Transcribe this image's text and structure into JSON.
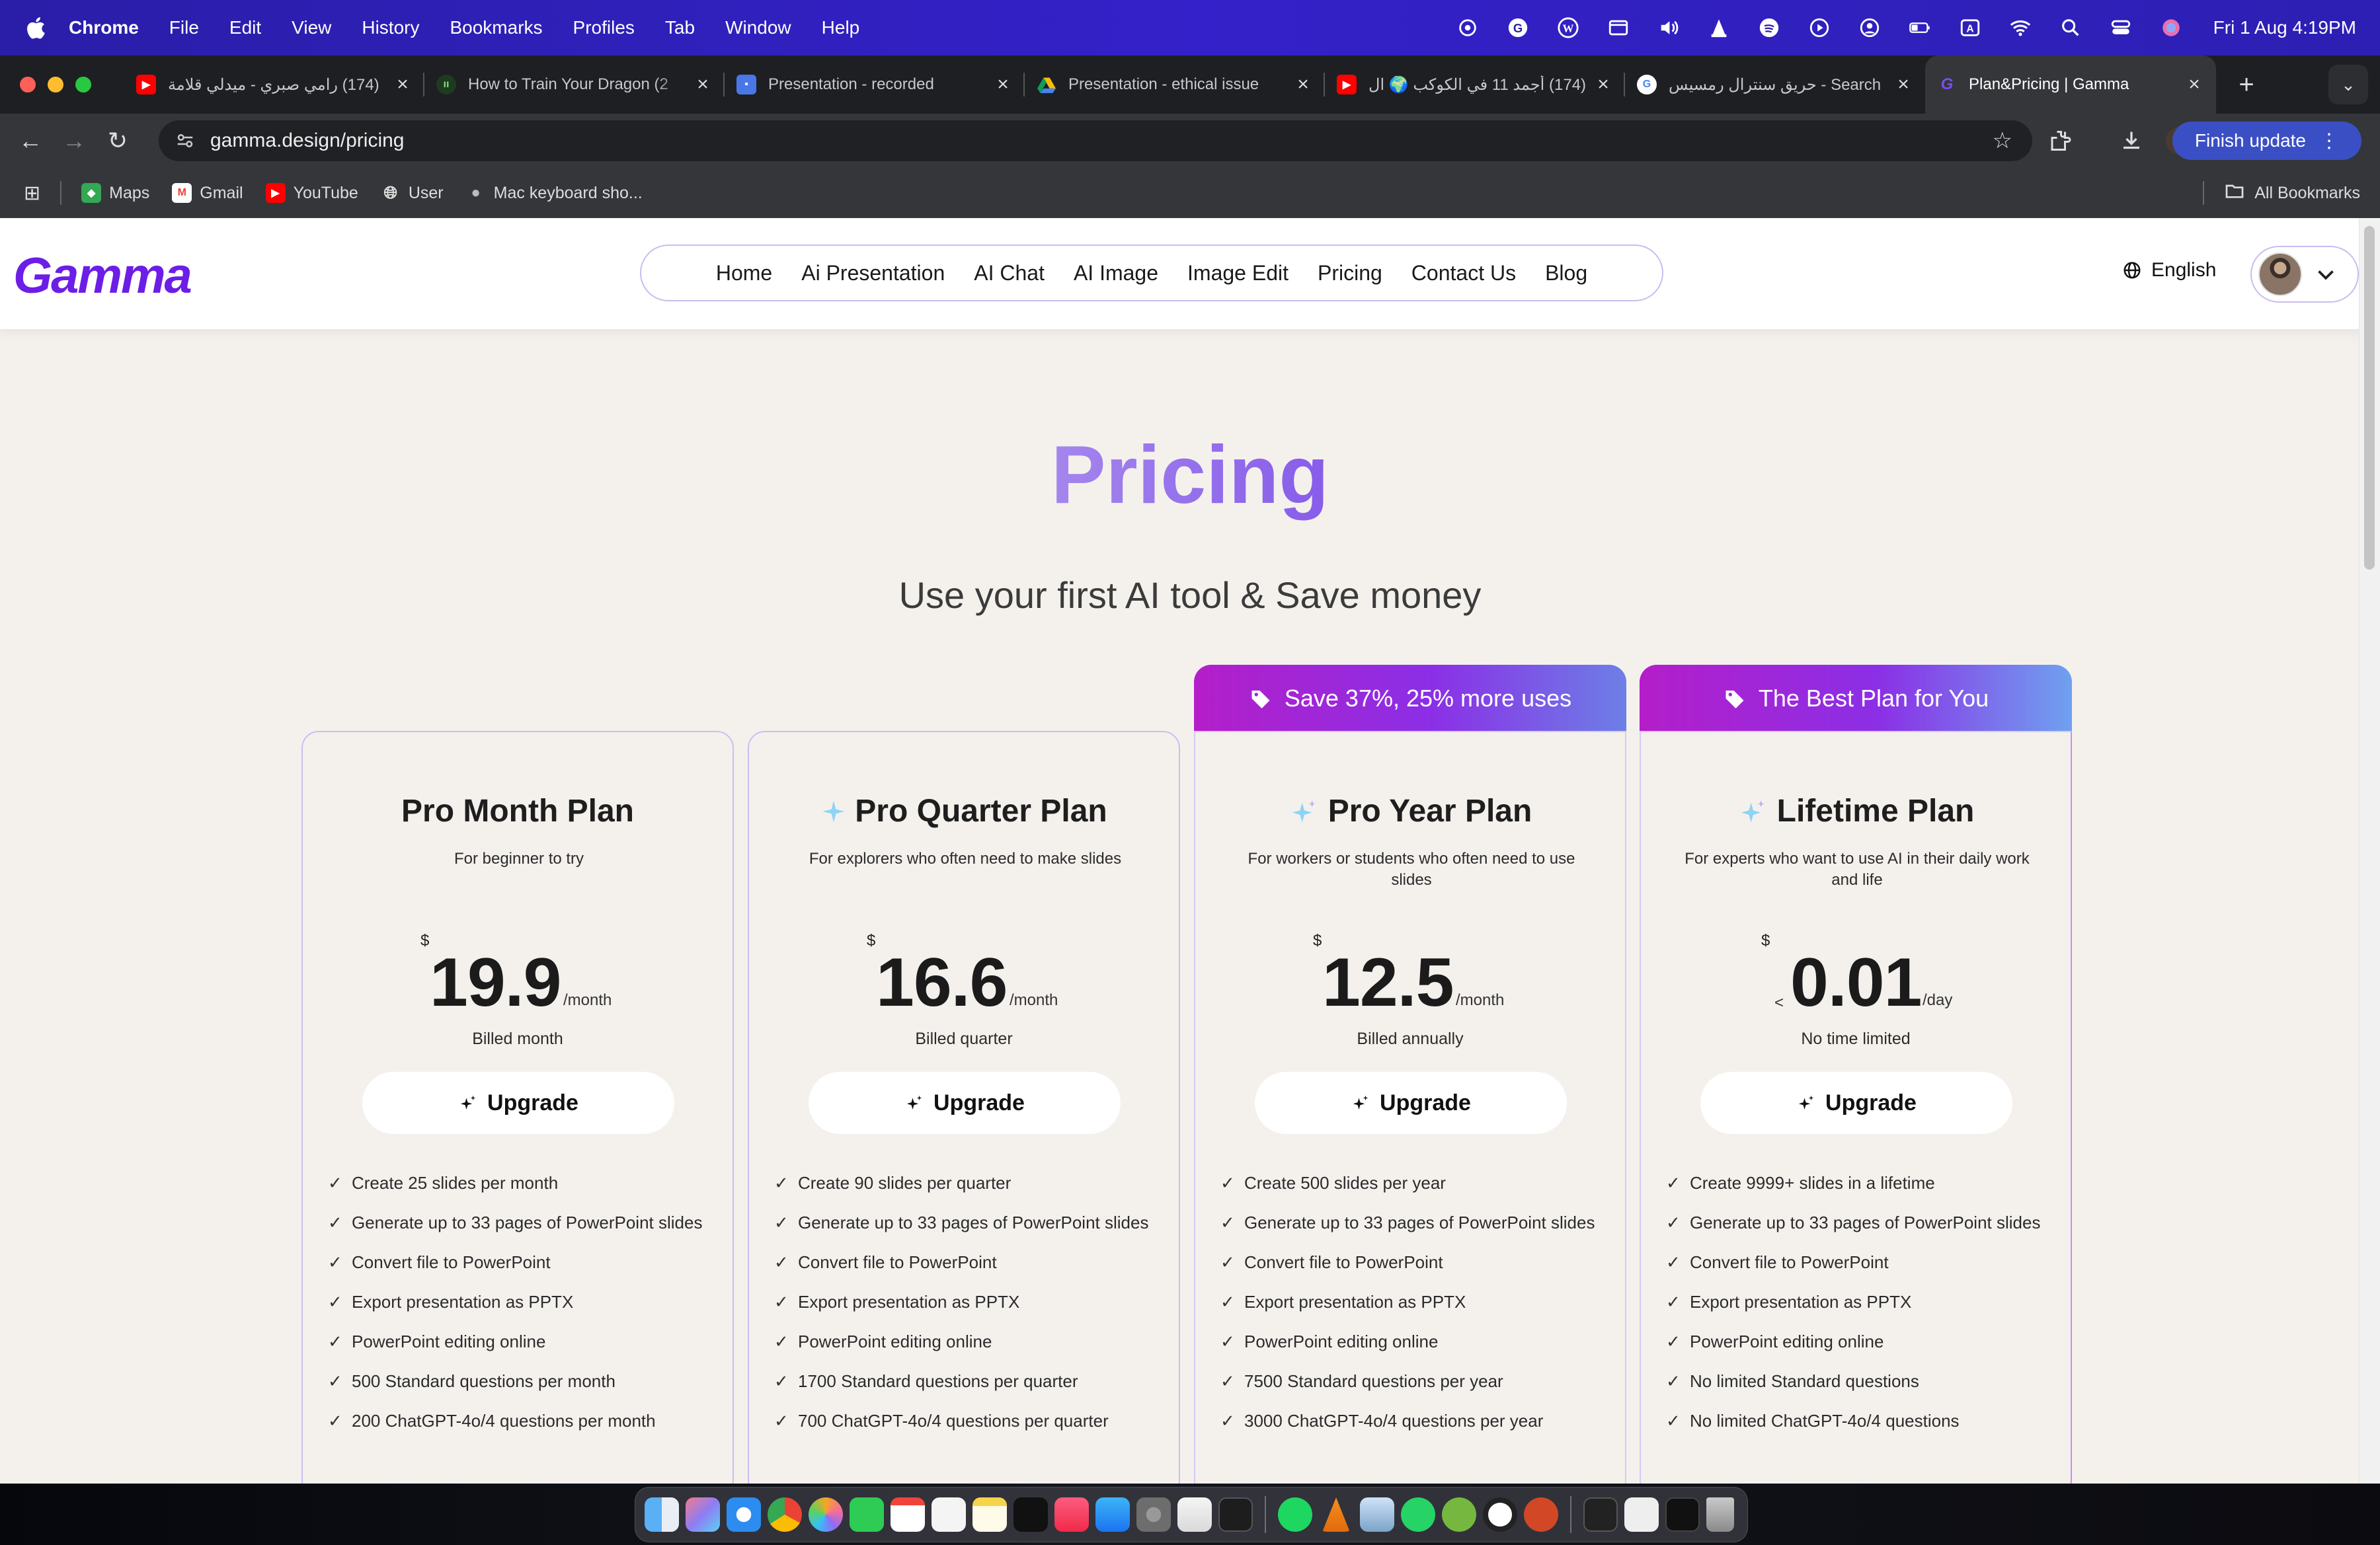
{
  "menubar": {
    "app": "Chrome",
    "items": [
      "File",
      "Edit",
      "View",
      "History",
      "Bookmarks",
      "Profiles",
      "Tab",
      "Window",
      "Help"
    ],
    "clock": "Fri 1 Aug  4:19PM"
  },
  "tabs": [
    {
      "title": "(174) رامي صبري - ميدلي قلامة",
      "icon": "youtube-icon"
    },
    {
      "title": "How to Train Your Dragon (2",
      "icon": "site-icon"
    },
    {
      "title": "Presentation - recorded",
      "icon": "slides-icon"
    },
    {
      "title": "Presentation - ethical issue",
      "icon": "drive-icon"
    },
    {
      "title": "(174) أجمد 11 في الكوكب 🌍 ال",
      "icon": "youtube-icon"
    },
    {
      "title": "حريق سنترال رمسيس - Search",
      "icon": "google-icon"
    },
    {
      "title": "Plan&Pricing | Gamma",
      "icon": "gamma-icon",
      "active": true
    }
  ],
  "toolbar": {
    "url": "gamma.design/pricing",
    "finish_update": "Finish update"
  },
  "bookmarks": {
    "items": [
      "Maps",
      "Gmail",
      "YouTube",
      "User",
      "Mac keyboard sho..."
    ],
    "all": "All Bookmarks"
  },
  "site": {
    "logo": "Gamma",
    "nav": [
      "Home",
      "Ai Presentation",
      "AI Chat",
      "AI Image",
      "Image Edit",
      "Pricing",
      "Contact Us",
      "Blog"
    ],
    "language": "English"
  },
  "hero": {
    "title": "Pricing",
    "subtitle": "Use your first AI tool & Save money"
  },
  "plans": [
    {
      "name": "Pro Month Plan",
      "desc": "For beginner to try",
      "currency": "$",
      "price": "19.9",
      "period": "/month",
      "billed": "Billed month",
      "cta": "Upgrade",
      "features": [
        "Create 25 slides per month",
        "Generate up to 33 pages of PowerPoint slides",
        "Convert file to PowerPoint",
        "Export presentation as PPTX",
        "PowerPoint editing online",
        "500 Standard questions per month",
        "200 ChatGPT-4o/4 questions per month"
      ]
    },
    {
      "name": "Pro Quarter Plan",
      "desc": "For explorers who often need to make slides",
      "currency": "$",
      "price": "16.6",
      "period": "/month",
      "billed": "Billed quarter",
      "cta": "Upgrade",
      "features": [
        "Create 90 slides per quarter",
        "Generate up to 33 pages of PowerPoint slides",
        "Convert file to PowerPoint",
        "Export presentation as PPTX",
        "PowerPoint editing online",
        "1700 Standard questions per quarter",
        "700 ChatGPT-4o/4 questions per quarter"
      ]
    },
    {
      "name": "Pro Year Plan",
      "banner": "Save 37%, 25% more uses",
      "desc": "For workers or students who often need to use slides",
      "currency": "$",
      "price": "12.5",
      "period": "/month",
      "billed": "Billed annually",
      "cta": "Upgrade",
      "features": [
        "Create 500 slides per year",
        "Generate up to 33 pages of PowerPoint slides",
        "Convert file to PowerPoint",
        "Export presentation as PPTX",
        "PowerPoint editing online",
        "7500 Standard questions per year",
        "3000 ChatGPT-4o/4 questions per year"
      ]
    },
    {
      "name": "Lifetime Plan",
      "banner": "The Best Plan for You",
      "desc": "For experts who want to use AI in their daily work and life",
      "currency": "$",
      "prefix": "<",
      "price": "0.01",
      "period": "/day",
      "billed": "No time limited",
      "cta": "Upgrade",
      "features": [
        "Create 9999+ slides in a lifetime",
        "Generate up to 33 pages of PowerPoint slides",
        "Convert file to PowerPoint",
        "Export presentation as PPTX",
        "PowerPoint editing online",
        "No limited Standard questions",
        "No limited ChatGPT-4o/4 questions"
      ]
    }
  ],
  "colors": {
    "brand": "#6c1ee6",
    "banner_start": "#b41ec9",
    "banner_end": "#6fa1ef",
    "page_bg": "#f4f1ed",
    "card_border": "#cdbdf2"
  }
}
